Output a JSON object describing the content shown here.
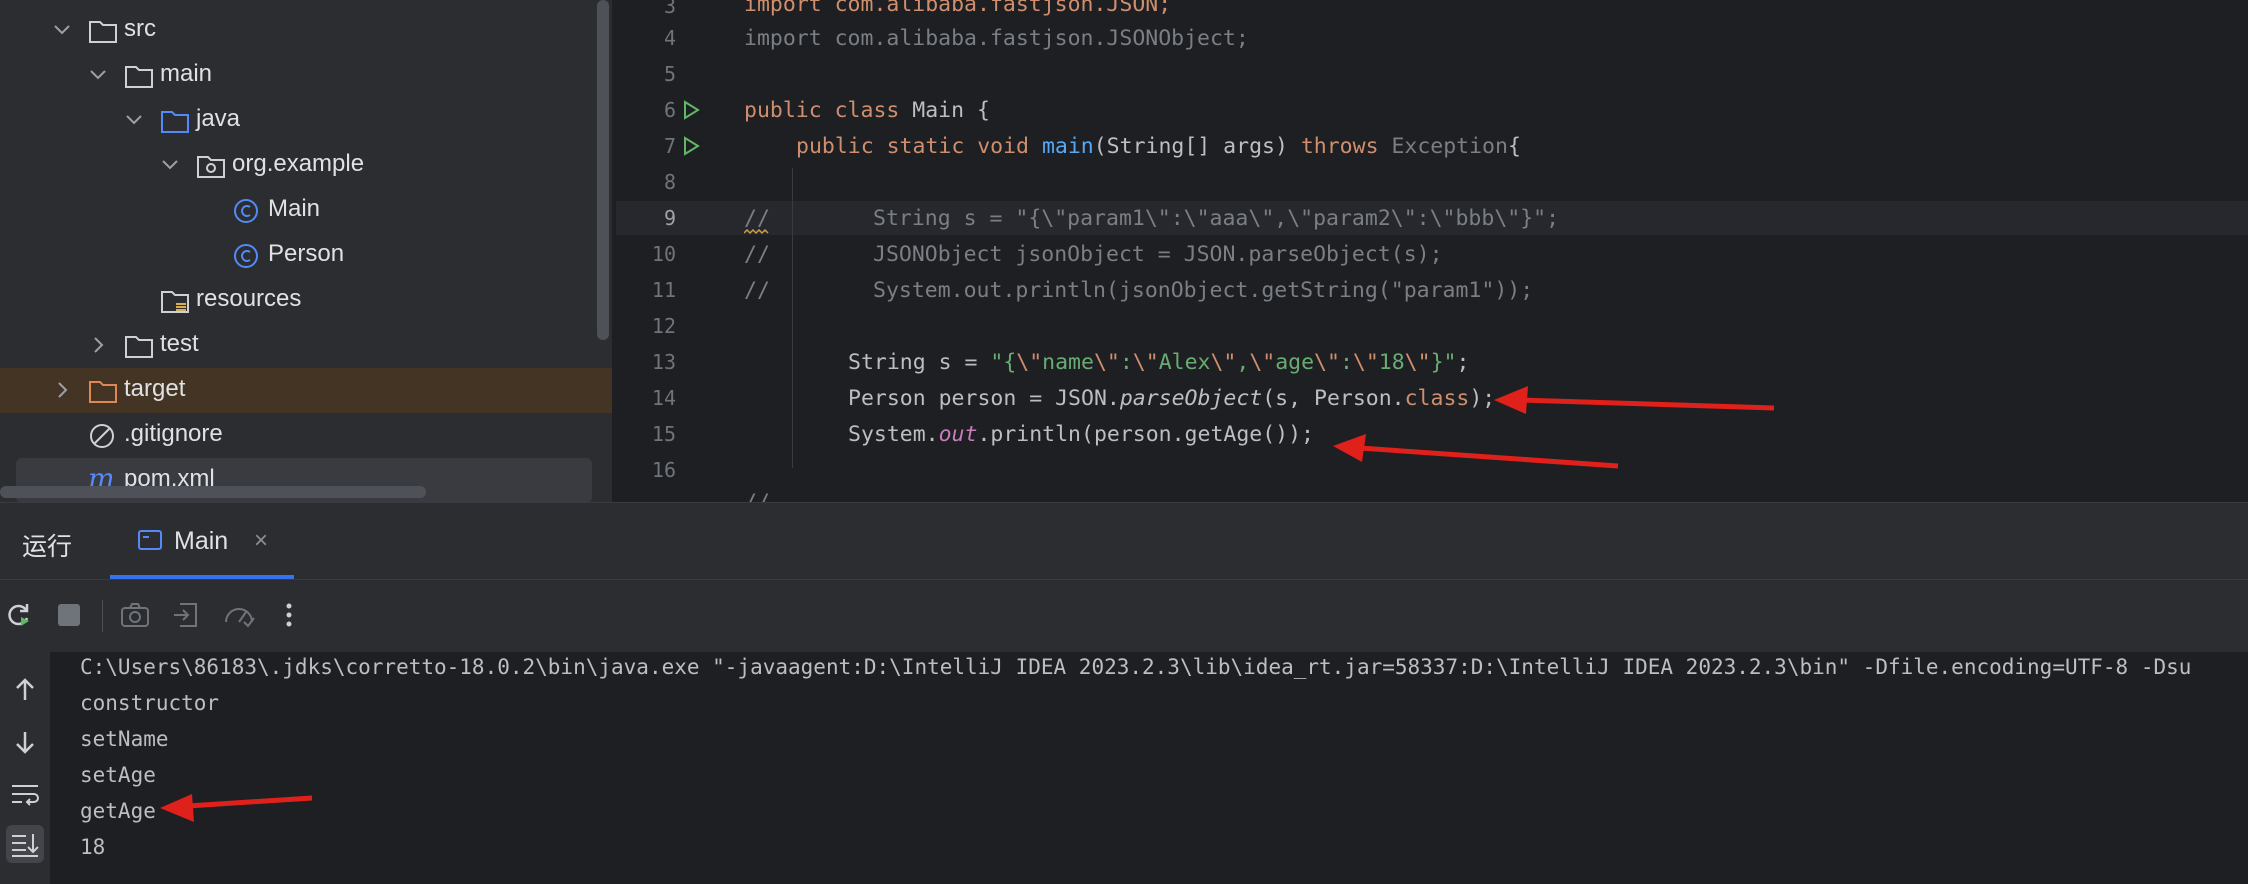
{
  "project_tree": {
    "items": [
      {
        "label": "src",
        "type": "folder",
        "expanded": true
      },
      {
        "label": "main",
        "type": "folder",
        "expanded": true
      },
      {
        "label": "java",
        "type": "source-folder",
        "expanded": true
      },
      {
        "label": "org.example",
        "type": "package",
        "expanded": true
      },
      {
        "label": "Main",
        "type": "class"
      },
      {
        "label": "Person",
        "type": "class"
      },
      {
        "label": "resources",
        "type": "resources-folder"
      },
      {
        "label": "test",
        "type": "folder",
        "expanded": false
      },
      {
        "label": "target",
        "type": "excluded-folder",
        "expanded": false
      },
      {
        "label": ".gitignore",
        "type": "ignore-file"
      },
      {
        "label": "pom.xml",
        "type": "maven-file"
      }
    ]
  },
  "editor": {
    "line_numbers": [
      "3",
      "4",
      "5",
      "6",
      "7",
      "8",
      "9",
      "10",
      "11",
      "12",
      "13",
      "14",
      "15",
      "16"
    ],
    "current_line": "9",
    "lines": {
      "l3": "import com.alibaba.fastjson.JSON;",
      "l4": "import com.alibaba.fastjson.JSONObject;",
      "l6_kw": "public class ",
      "l6_rest": "Main {",
      "l7_kw": "public static void ",
      "l7_fn": "main",
      "l7_mid": "(String[] args) ",
      "l7_kw2": "throws ",
      "l7_exc": "Exception",
      "l7_end": "{",
      "l9_cmt": "//",
      "l9_code": "String s = \"{\\\"param1\\\":\\\"aaa\\\",\\\"param2\\\":\\\"bbb\\\"}\";",
      "l10_cmt": "//",
      "l10_code": "JSONObject jsonObject = JSON.parseObject(s);",
      "l11_cmt": "//",
      "l11_code": "System.out.println(jsonObject.getString(\"param1\"));",
      "l13_a": "String s = ",
      "l13_s1": "\"{",
      "l13_e1": "\\\"",
      "l13_s2": "name",
      "l13_e2": "\\\"",
      "l13_s3": ":",
      "l13_e3": "\\\"",
      "l13_s4": "Alex",
      "l13_e4": "\\\"",
      "l13_s5": ",",
      "l13_e5": "\\\"",
      "l13_s6": "age",
      "l13_e6": "\\\"",
      "l13_s7": ":",
      "l13_e7": "\\\"",
      "l13_s8": "18",
      "l13_e8": "\\\"",
      "l13_s9": "}\"",
      "l13_end": ";",
      "l14_a": "Person person = JSON.",
      "l14_fn": "parseObject",
      "l14_b": "(s, Person.",
      "l14_kw": "class",
      "l14_c": ");",
      "l15_a": "System.",
      "l15_fld": "out",
      "l15_b": ".println(person.getAge());",
      "l17_cmt": "//"
    }
  },
  "run_window": {
    "title": "运行",
    "tab_label": "Main",
    "tab_close": "×",
    "toolbar": [
      "rerun-icon",
      "stop-icon",
      "camera-icon",
      "export-icon",
      "profiler-icon",
      "more-icon"
    ],
    "side": [
      "up-arrow-icon",
      "down-arrow-icon",
      "soft-wrap-icon",
      "scroll-to-end-icon"
    ],
    "console_lines": [
      "C:\\Users\\86183\\.jdks\\corretto-18.0.2\\bin\\java.exe \"-javaagent:D:\\IntelliJ IDEA 2023.2.3\\lib\\idea_rt.jar=58337:D:\\IntelliJ IDEA 2023.2.3\\bin\" -Dfile.encoding=UTF-8 -Dsu",
      "constructor",
      "setName",
      "setAge",
      "getAge",
      "18"
    ]
  },
  "colors": {
    "annotation_arrow": "#e0201a",
    "accent": "#3574f0"
  }
}
